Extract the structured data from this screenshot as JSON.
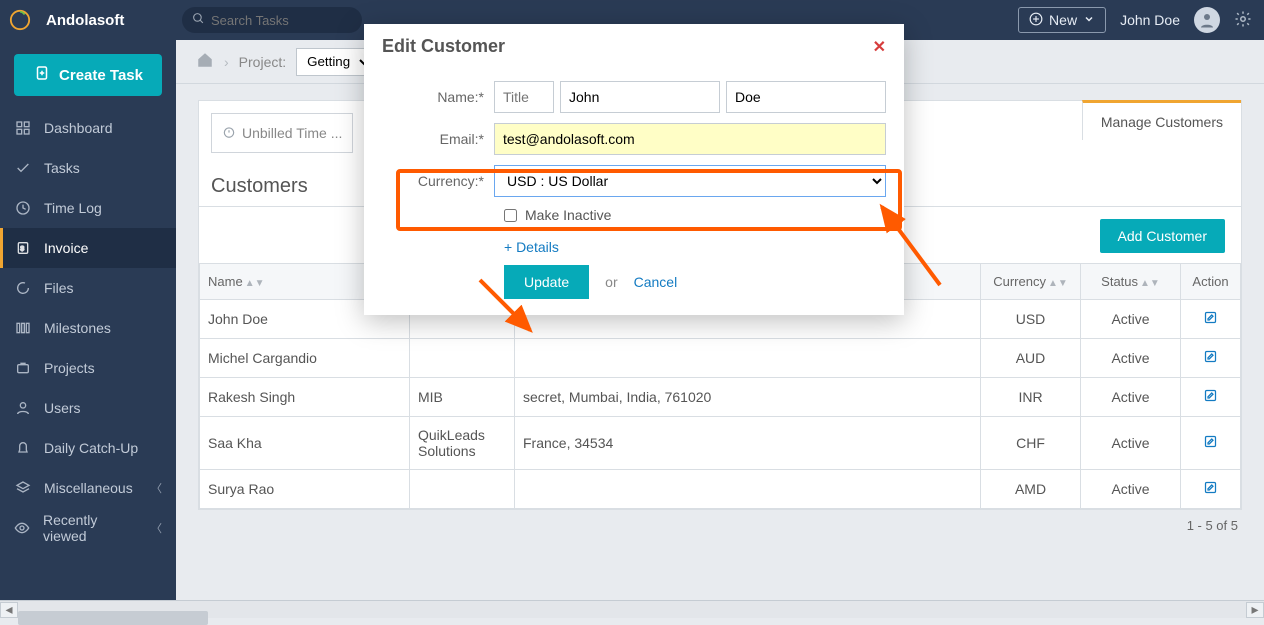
{
  "header": {
    "brand": "Andolasoft",
    "search_placeholder": "Search Tasks",
    "new_label": "New",
    "user_name": "John Doe"
  },
  "sidebar": {
    "create_label": "Create Task",
    "items": [
      {
        "label": "Dashboard"
      },
      {
        "label": "Tasks"
      },
      {
        "label": "Time Log"
      },
      {
        "label": "Invoice"
      },
      {
        "label": "Files"
      },
      {
        "label": "Milestones"
      },
      {
        "label": "Projects"
      },
      {
        "label": "Users"
      },
      {
        "label": "Daily Catch-Up"
      },
      {
        "label": "Miscellaneous"
      },
      {
        "label": "Recently viewed"
      }
    ]
  },
  "breadcrumb": {
    "project_label": "Project:",
    "project_selected": "Getting"
  },
  "main": {
    "unbilled_label": "Unbilled Time ...",
    "section_title": "Customers",
    "tab_active": "Manage Customers",
    "add_customer": "Add Customer",
    "paging": "1 - 5 of 5",
    "table": {
      "headers": {
        "name": "Name",
        "currency": "Currency",
        "status": "Status",
        "action": "Action"
      },
      "rows": [
        {
          "name": "John Doe",
          "company": "",
          "address": "",
          "currency": "USD",
          "status": "Active"
        },
        {
          "name": "Michel Cargandio",
          "company": "",
          "address": "",
          "currency": "AUD",
          "status": "Active"
        },
        {
          "name": "Rakesh Singh",
          "company": "MIB",
          "address": "secret, Mumbai, India, 761020",
          "currency": "INR",
          "status": "Active"
        },
        {
          "name": "Saa Kha",
          "company": "QuikLeads Solutions",
          "address": "France, 34534",
          "currency": "CHF",
          "status": "Active"
        },
        {
          "name": "Surya Rao",
          "company": "",
          "address": "",
          "currency": "AMD",
          "status": "Active"
        }
      ]
    }
  },
  "modal": {
    "title": "Edit Customer",
    "labels": {
      "name": "Name:*",
      "email": "Email:*",
      "currency": "Currency:*",
      "inactive": "Make Inactive",
      "details": "+ Details",
      "update": "Update",
      "or": "or",
      "cancel": "Cancel"
    },
    "fields": {
      "title_placeholder": "Title",
      "first_name": "John",
      "last_name": "Doe",
      "email": "test@andolasoft.com",
      "currency_selected": "USD : US Dollar"
    }
  }
}
